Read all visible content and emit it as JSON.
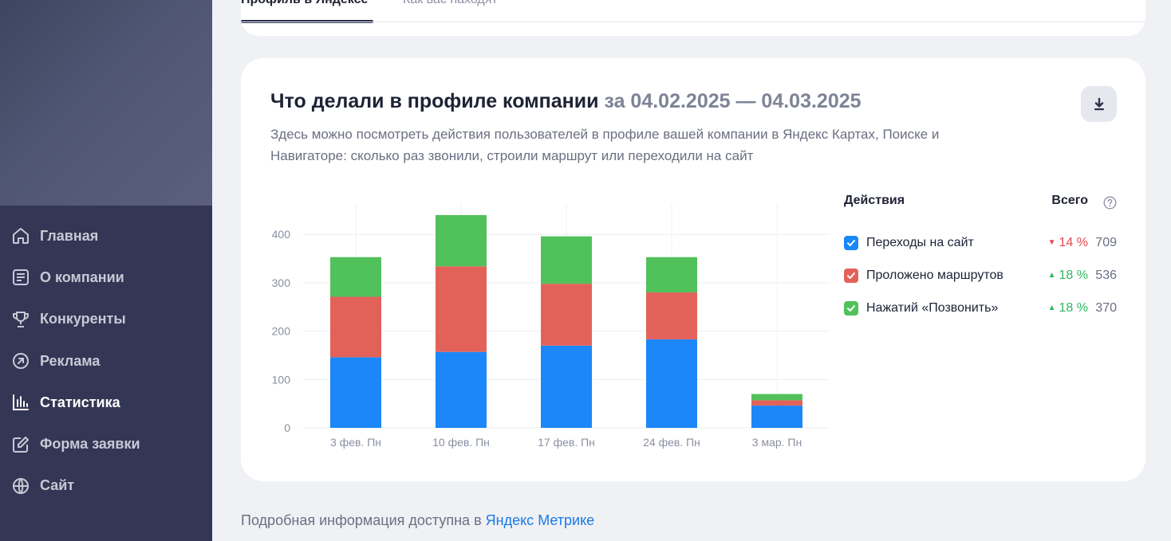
{
  "tabs": [
    {
      "label": "Профиль в Яндексе",
      "active": true
    },
    {
      "label": "Как вас находят",
      "active": false
    }
  ],
  "sidebar": {
    "items": [
      {
        "label": "Главная",
        "icon": "home-icon"
      },
      {
        "label": "О компании",
        "icon": "document-icon"
      },
      {
        "label": "Конкуренты",
        "icon": "trophy-icon"
      },
      {
        "label": "Реклама",
        "icon": "arrow-circle-icon"
      },
      {
        "label": "Статистика",
        "icon": "bar-chart-icon",
        "active": true
      },
      {
        "label": "Форма заявки",
        "icon": "edit-icon"
      },
      {
        "label": "Сайт",
        "icon": "globe-icon"
      }
    ]
  },
  "card": {
    "title": "Что делали в профиле компании",
    "period": "за 04.02.2025 — 04.03.2025",
    "description": "Здесь можно посмотреть действия пользователей в профиле вашей компании в Яндекс Картах, Поиске и Навигаторе: сколько раз звонили, строили маршрут или переходили на сайт"
  },
  "legend": {
    "header": "Действия",
    "total_label": "Всего",
    "items": [
      {
        "label": "Переходы на сайт",
        "delta": "14 %",
        "direction": "down",
        "total": "709",
        "color": "#1b87f9"
      },
      {
        "label": "Проложено маршрутов",
        "delta": "18 %",
        "direction": "up",
        "total": "536",
        "color": "#e2625a"
      },
      {
        "label": "Нажатий «Позвонить»",
        "delta": "18 %",
        "direction": "up",
        "total": "370",
        "color": "#51c15c"
      }
    ]
  },
  "chart_data": {
    "type": "bar",
    "stacked": true,
    "categories": [
      "3 фев. Пн",
      "10 фев. Пн",
      "17 фев. Пн",
      "24 фев. Пн",
      "3 мар. Пн"
    ],
    "series": [
      {
        "name": "Переходы на сайт",
        "color": "#1b87f9",
        "values": [
          146,
          157,
          170,
          183,
          46
        ]
      },
      {
        "name": "Проложено маршрутов",
        "color": "#e2625a",
        "values": [
          125,
          177,
          128,
          97,
          11
        ]
      },
      {
        "name": "Нажатий «Позвонить»",
        "color": "#51c15c",
        "values": [
          82,
          106,
          98,
          73,
          13
        ]
      }
    ],
    "yticks": [
      0,
      100,
      200,
      300,
      400
    ],
    "ylim": [
      0,
      450
    ],
    "grid": true
  },
  "footer": {
    "text": "Подробная информация доступна в",
    "link": "Яндекс Метрике"
  }
}
